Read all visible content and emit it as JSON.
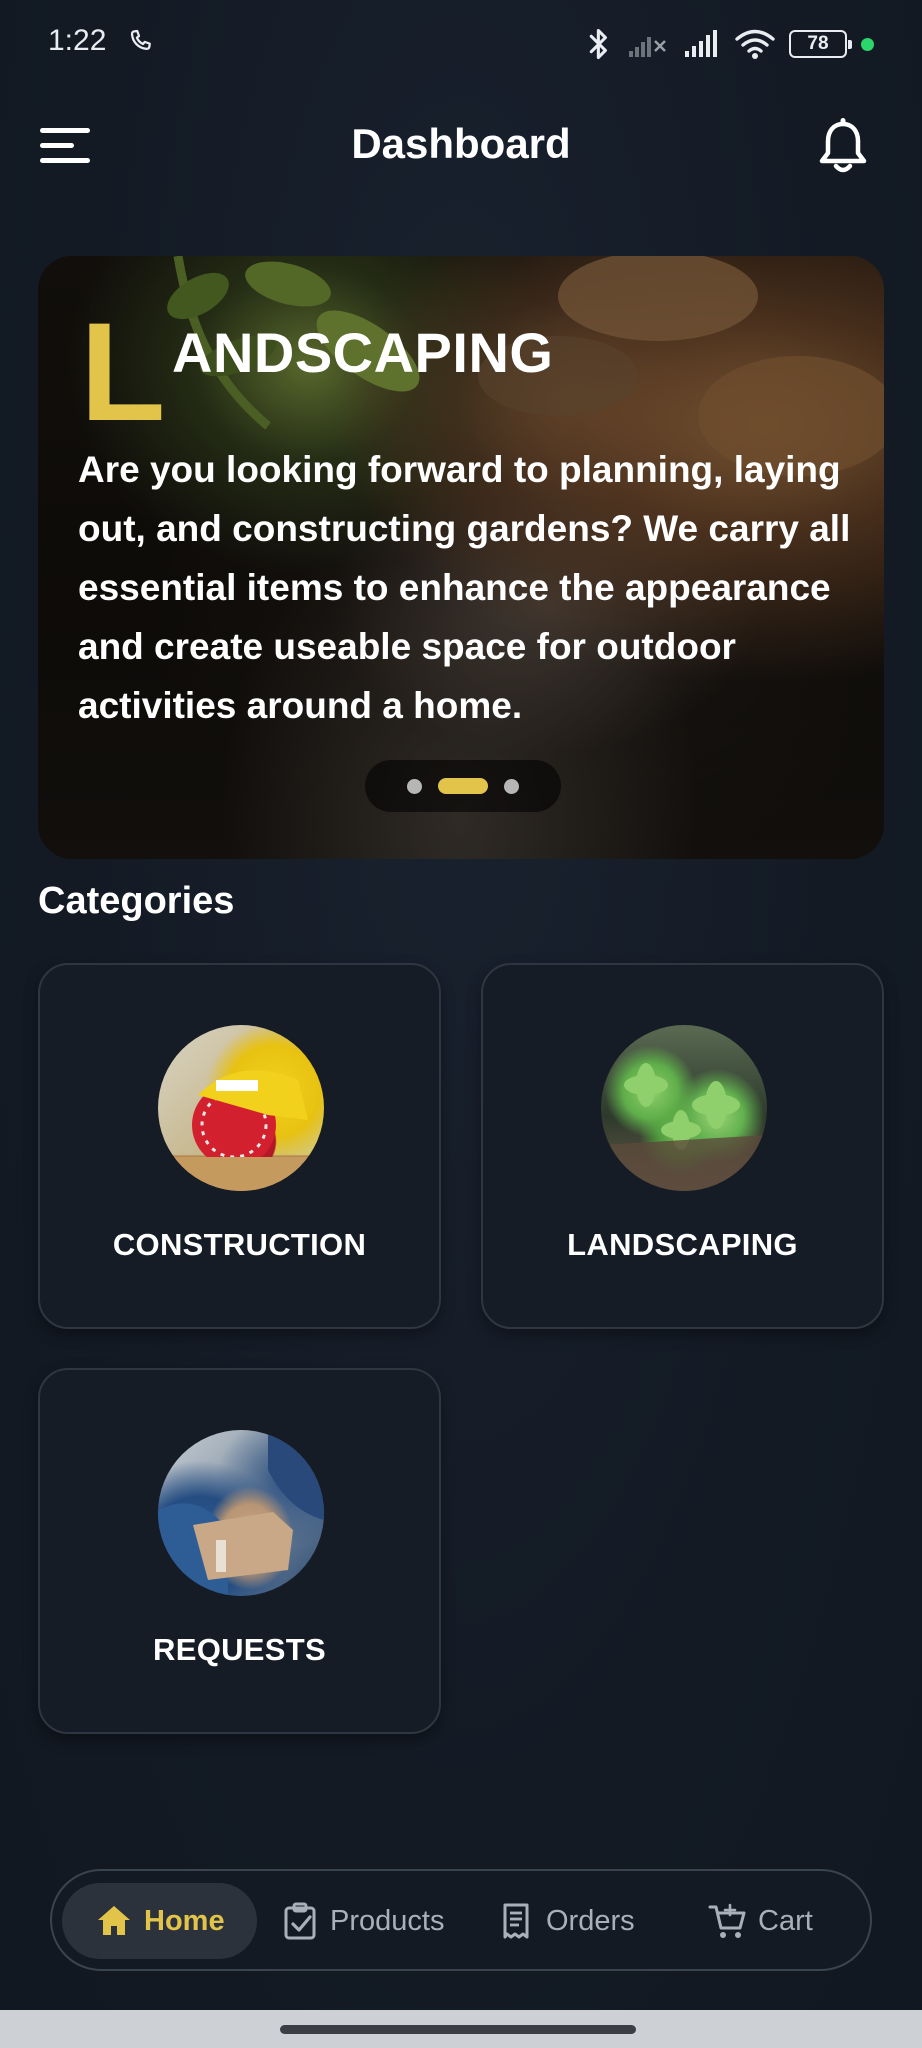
{
  "status_bar": {
    "time": "1:22",
    "battery": "78",
    "icons": [
      "phone-call-icon",
      "bluetooth-icon",
      "signal-off-icon",
      "signal-icon",
      "wifi-icon",
      "battery-icon"
    ],
    "indicator_color": "#2bd66b"
  },
  "app_bar": {
    "title": "Dashboard",
    "menu_icon": "hamburger-menu-icon",
    "notification_icon": "bell-icon"
  },
  "banner": {
    "initial": "L",
    "title": "ANDSCAPING",
    "text": "Are you looking forward to planning, laying out, and constructing gardens? We carry all essential items to enhance the appearance and create useable space for outdoor activities around a home.",
    "slides": 3,
    "active_slide": 2,
    "accent_color": "#e3c44a"
  },
  "categories": {
    "title": "Categories",
    "items": [
      {
        "label": "CONSTRUCTION",
        "image": "circular-saw-photo"
      },
      {
        "label": "LANDSCAPING",
        "image": "succulent-plants-photo"
      },
      {
        "label": "REQUESTS",
        "image": "package-delivery-photo"
      }
    ]
  },
  "bottom_nav": {
    "items": [
      {
        "label": "Home",
        "icon": "home-icon",
        "active": true
      },
      {
        "label": "Products",
        "icon": "clipboard-check-icon",
        "active": false
      },
      {
        "label": "Orders",
        "icon": "receipt-icon",
        "active": false
      },
      {
        "label": "Cart",
        "icon": "cart-icon",
        "active": false
      }
    ],
    "active_color": "#e3c44a"
  }
}
